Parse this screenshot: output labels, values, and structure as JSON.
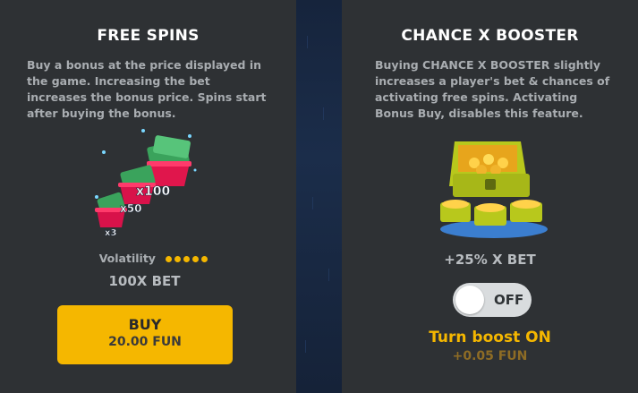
{
  "free_spins": {
    "title": "FREE SPINS",
    "description": "Buy a bonus at the price displayed in\nthe game. Increasing the bet\nincreases the bonus price. Spins start\nafter buying the bonus.",
    "multipliers": [
      "x100",
      "x50",
      "x3"
    ],
    "volatility_label": "Volatility",
    "volatility_level": 5,
    "volatility_max": 5,
    "bet_label": "100X BET",
    "buy_label": "BUY",
    "price_label": "20.00 FUN"
  },
  "chance_booster": {
    "title": "CHANCE X BOOSTER",
    "description": "Buying CHANCE X BOOSTER slightly\nincreases a player's bet & chances of\nactivating free spins. Activating\nBonus Buy, disables this feature.",
    "bet_label": "+25% X BET",
    "toggle_state_label": "OFF",
    "toggle_on": false,
    "boost_label": "Turn boost ON",
    "boost_cost": "+0.05 FUN"
  },
  "colors": {
    "accent": "#f5b700",
    "panel": "#2e3134",
    "divider": "#18263f"
  }
}
